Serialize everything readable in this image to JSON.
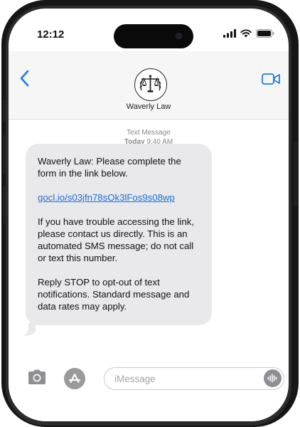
{
  "status_bar": {
    "time": "12:12"
  },
  "header": {
    "contact_name": "Waverly Law"
  },
  "message_meta": {
    "label": "Text Message",
    "day": "Today",
    "time": "9:40 AM"
  },
  "message": {
    "line_1": "Waverly Law: Please complete the form in the link below.",
    "link": "gocl.io/s03jfn78sOk3lFos9s08wp",
    "line_2": "If you have trouble accessing the link, please contact us directly. This is an automated SMS message; do not call or text this number.",
    "line_3": "Reply STOP to opt-out of text notifications. Standard message and data rates may apply."
  },
  "composer": {
    "placeholder": "iMessage"
  },
  "icons": {
    "back": "chevron-left-icon",
    "video": "video-camera-icon",
    "camera": "camera-icon",
    "apps": "app-store-icon",
    "voice": "waveform-icon",
    "signal": "cellular-signal-icon",
    "wifi": "wifi-icon",
    "battery": "battery-icon",
    "avatar": "scales-of-justice-icon"
  },
  "colors": {
    "accent": "#1a7cf0",
    "bubble": "#e9e9eb",
    "link": "#1a6fd6"
  }
}
